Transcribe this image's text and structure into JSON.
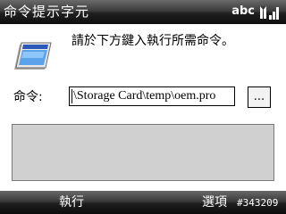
{
  "titlebar": {
    "title": "命令提示字元",
    "input_mode": "abc",
    "icons": [
      "signal-strength-icon"
    ]
  },
  "dialog": {
    "icon": "program-window-icon",
    "prompt": "請於下方鍵入執行所需命令。",
    "command_label": "命令:",
    "command_value": "\\Storage Card\\temp\\oem.pro",
    "browse_label": "...",
    "output": ""
  },
  "softkeys": {
    "left": "執行",
    "right": "選項"
  },
  "watermark": "#343209",
  "colors": {
    "bar_dark": "#0e0e0e",
    "output_bg": "#d0d0d0"
  }
}
